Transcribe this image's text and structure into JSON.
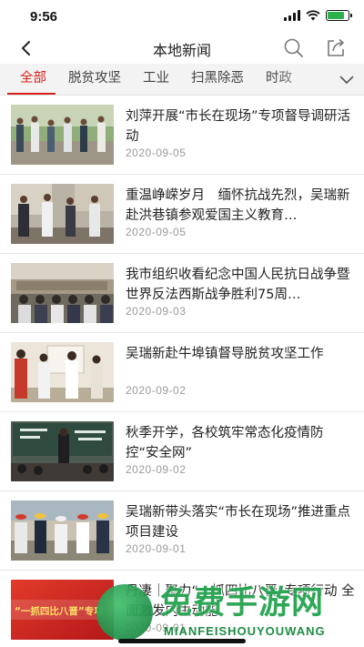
{
  "status_bar": {
    "time": "9:56"
  },
  "nav": {
    "title": "本地新闻"
  },
  "tabs": [
    {
      "label": "全部",
      "active": true
    },
    {
      "label": "脱贫攻坚",
      "active": false
    },
    {
      "label": "工业",
      "active": false
    },
    {
      "label": "扫黑除恶",
      "active": false
    },
    {
      "label": "时政",
      "active": false
    }
  ],
  "news": [
    {
      "title": "刘萍开展“市长在现场”专项督导调研活动",
      "date": "2020-09-05"
    },
    {
      "title": "重温峥嵘岁月　缅怀抗战先烈，吴瑞新赴洪巷镇参观爱国主义教育…",
      "date": "2020-09-05"
    },
    {
      "title": "我市组织收看纪念中国人民抗日战争暨世界反法西斯战争胜利75周…",
      "date": "2020-09-03"
    },
    {
      "title": "吴瑞新赴牛埠镇督导脱贫攻坚工作",
      "date": "2020-09-02"
    },
    {
      "title": "秋季开学，各校筑牢常态化疫情防控“安全网”",
      "date": "2020-09-02"
    },
    {
      "title": "吴瑞新带头落实“市长在现场”推进重点项目建设",
      "date": "2020-09-01"
    },
    {
      "title": "丹凄｜聚力“一抓四比八晋”专项行动 全面激发内生动能",
      "date": "2020-09-01",
      "thumb_caption": "“一抓四比八晋”专项"
    }
  ],
  "watermark": {
    "main": "免费手游网",
    "sub": "MIANFEISHOUYOUWANG"
  },
  "colors": {
    "accent": "#d8231d",
    "tab_bg": "#f3f3f3",
    "date": "#9a9a9a",
    "watermark": "#23a34f"
  }
}
